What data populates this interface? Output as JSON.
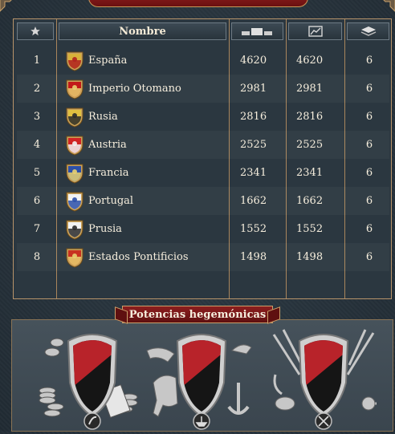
{
  "window": {
    "top_banner_text": ""
  },
  "ranking": {
    "headers": {
      "rank_icon": "star-icon",
      "name": "Nombre",
      "col_value1_icon": "coins-icon",
      "col_value2_icon": "trend-chart-icon",
      "col_value3_icon": "stack-icon"
    },
    "rows": [
      {
        "rank": "1",
        "name": "España",
        "v1": "4620",
        "v2": "4620",
        "v3": "6",
        "colors": [
          "#d8b23a",
          "#b02020"
        ]
      },
      {
        "rank": "2",
        "name": "Imperio Otomano",
        "v1": "2981",
        "v2": "2981",
        "v3": "6",
        "colors": [
          "#c21a1a",
          "#e8d070"
        ]
      },
      {
        "rank": "3",
        "name": "Rusia",
        "v1": "2816",
        "v2": "2816",
        "v3": "6",
        "colors": [
          "#e0c040",
          "#2a2a2a"
        ]
      },
      {
        "rank": "4",
        "name": "Austria",
        "v1": "2525",
        "v2": "2525",
        "v3": "6",
        "colors": [
          "#d02424",
          "#f2f2f2"
        ]
      },
      {
        "rank": "5",
        "name": "Francia",
        "v1": "2341",
        "v2": "2341",
        "v3": "6",
        "colors": [
          "#2c4fa8",
          "#e8d070"
        ]
      },
      {
        "rank": "6",
        "name": "Portugal",
        "v1": "1662",
        "v2": "1662",
        "v3": "6",
        "colors": [
          "#f2f2f2",
          "#2c4fa8"
        ]
      },
      {
        "rank": "7",
        "name": "Prusia",
        "v1": "1552",
        "v2": "1552",
        "v3": "6",
        "colors": [
          "#f2f2f2",
          "#2a2a2a"
        ]
      },
      {
        "rank": "8",
        "name": "Estados Pontificios",
        "v1": "1498",
        "v2": "1498",
        "v3": "6",
        "colors": [
          "#c83020",
          "#e8d070"
        ]
      }
    ]
  },
  "hegemonies": {
    "title": "Potencias hegemónicas",
    "items": [
      {
        "type": "economic",
        "icon": "coins-hegemony-icon",
        "badge_icon": "feather-icon"
      },
      {
        "type": "naval",
        "icon": "naval-hegemony-icon",
        "badge_icon": "ship-icon"
      },
      {
        "type": "military",
        "icon": "military-hegemony-icon",
        "badge_icon": "crossed-swords-icon"
      }
    ],
    "shield_colors": [
      "#b8232a",
      "#151515"
    ]
  }
}
